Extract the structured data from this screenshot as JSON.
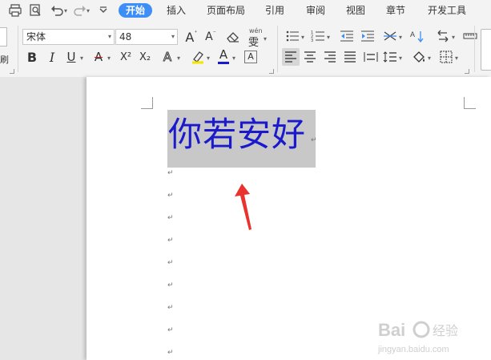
{
  "menubar": {
    "tabs": [
      {
        "label": "开始",
        "active": true
      },
      {
        "label": "插入"
      },
      {
        "label": "页面布局"
      },
      {
        "label": "引用"
      },
      {
        "label": "审阅"
      },
      {
        "label": "视图"
      },
      {
        "label": "章节"
      },
      {
        "label": "开发工具"
      }
    ]
  },
  "ribbon": {
    "format_painter_label": "刷",
    "font_name": "宋体",
    "font_size": "48",
    "bold": "B",
    "italic": "I",
    "underline": "U",
    "font_color_letter": "A",
    "highlight_char": "A",
    "char_shading": "A",
    "phonetic_label": "wén",
    "phonetic_char": "雯",
    "grow_font": "A",
    "shrink_font": "A",
    "superscript": "X²",
    "subscript": "X₂",
    "accent_blue": "#3d8ef7",
    "font_color_red": "#e02020",
    "font_color_blue": "#1a1acc"
  },
  "document": {
    "heading_text": "你若安好",
    "heading_color": "#1a1acc",
    "paragraph_mark": "↵"
  },
  "watermark": {
    "brand": "Bai",
    "brand2": "经验",
    "url": "jingyan.baidu.com"
  }
}
